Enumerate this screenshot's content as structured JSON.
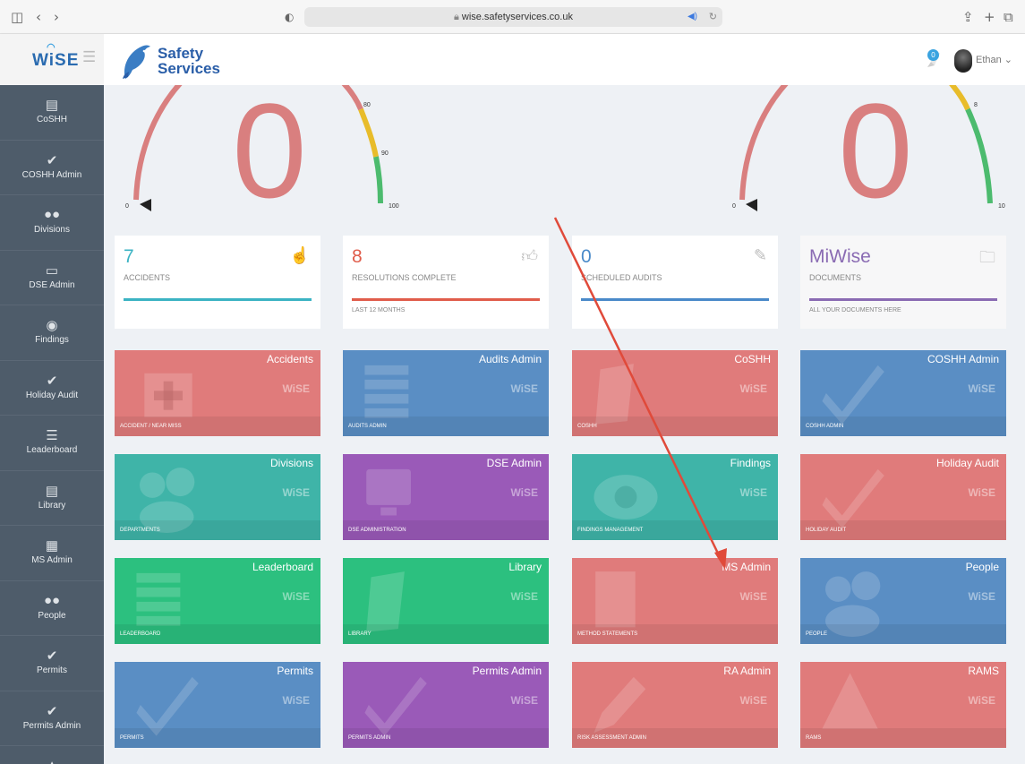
{
  "browser": {
    "url": "wise.safetyservices.co.uk"
  },
  "header": {
    "logo_text": "WiSE",
    "brand_line1": "Safety",
    "brand_line2": "Services",
    "notification_count": "0",
    "user_name": "Ethan ⌄"
  },
  "sidebar": {
    "items": [
      {
        "label": "CoSHH",
        "icon": "book-icon"
      },
      {
        "label": "COSHH Admin",
        "icon": "check-icon"
      },
      {
        "label": "Divisions",
        "icon": "people-icon"
      },
      {
        "label": "DSE Admin",
        "icon": "monitor-icon"
      },
      {
        "label": "Findings",
        "icon": "eye-icon"
      },
      {
        "label": "Holiday Audit",
        "icon": "check-icon"
      },
      {
        "label": "Leaderboard",
        "icon": "list-icon"
      },
      {
        "label": "Library",
        "icon": "book-icon"
      },
      {
        "label": "MS Admin",
        "icon": "document-icon"
      },
      {
        "label": "People",
        "icon": "people-icon"
      },
      {
        "label": "Permits",
        "icon": "check-icon"
      },
      {
        "label": "Permits Admin",
        "icon": "check-icon"
      },
      {
        "label": "",
        "icon": "triangle-icon"
      }
    ]
  },
  "gauges": [
    {
      "value": "0",
      "ticks": [
        "0",
        "80",
        "90",
        "100"
      ]
    },
    {
      "value": "0",
      "ticks": [
        "0",
        "8",
        "10"
      ]
    }
  ],
  "stats": [
    {
      "value": "7",
      "label": "ACCIDENTS",
      "sub": "",
      "color": "#3bb3c3",
      "icon": "hand-icon"
    },
    {
      "value": "8",
      "label": "RESOLUTIONS COMPLETE",
      "sub": "LAST 12 MONTHS",
      "color": "#e05d4b",
      "icon": "thumbs-up-icon"
    },
    {
      "value": "0",
      "label": "SCHEDULED AUDITS",
      "sub": "",
      "color": "#4a8ac9",
      "icon": "edit-icon"
    },
    {
      "value": "MiWise",
      "label": "DOCUMENTS",
      "sub": "ALL YOUR DOCUMENTS HERE",
      "color": "#8a6bb3",
      "icon": "folder-icon"
    }
  ],
  "tiles": [
    {
      "title": "Accidents",
      "sub": "ACCIDENT / NEAR MISS",
      "color": "#e07b7b",
      "icon": "first-aid-icon"
    },
    {
      "title": "Audits Admin",
      "sub": "AUDITS ADMIN",
      "color": "#5a8ec4",
      "icon": "list-icon"
    },
    {
      "title": "CoSHH",
      "sub": "COSHH",
      "color": "#e07b7b",
      "icon": "book-icon"
    },
    {
      "title": "COSHH Admin",
      "sub": "COSHH ADMIN",
      "color": "#5a8ec4",
      "icon": "check-icon"
    },
    {
      "title": "Divisions",
      "sub": "DEPARTMENTS",
      "color": "#3fb4a8",
      "icon": "people-icon"
    },
    {
      "title": "DSE Admin",
      "sub": "DSE ADMINISTRATION",
      "color": "#9a5ab8",
      "icon": "monitor-icon"
    },
    {
      "title": "Findings",
      "sub": "FINDINGS MANAGEMENT",
      "color": "#3fb4a8",
      "icon": "eye-icon"
    },
    {
      "title": "Holiday Audit",
      "sub": "HOLIDAY AUDIT",
      "color": "#e07b7b",
      "icon": "check-icon"
    },
    {
      "title": "Leaderboard",
      "sub": "LEADERBOARD",
      "color": "#2cc07f",
      "icon": "list-icon"
    },
    {
      "title": "Library",
      "sub": "LIBRARY",
      "color": "#2cc07f",
      "icon": "book-icon"
    },
    {
      "title": "MS Admin",
      "sub": "METHOD STATEMENTS",
      "color": "#e07b7b",
      "icon": "document-icon"
    },
    {
      "title": "People",
      "sub": "PEOPLE",
      "color": "#5a8ec4",
      "icon": "people-icon"
    },
    {
      "title": "Permits",
      "sub": "PERMITS",
      "color": "#5a8ec4",
      "icon": "check-icon"
    },
    {
      "title": "Permits Admin",
      "sub": "PERMITS ADMIN",
      "color": "#9a5ab8",
      "icon": "check-icon"
    },
    {
      "title": "RA Admin",
      "sub": "RISK ASSESSMENT ADMIN",
      "color": "#e07b7b",
      "icon": "pencil-icon"
    },
    {
      "title": "RAMS",
      "sub": "RAMS",
      "color": "#e07b7b",
      "icon": "warning-icon"
    }
  ],
  "tile_watermark": "WiSE"
}
